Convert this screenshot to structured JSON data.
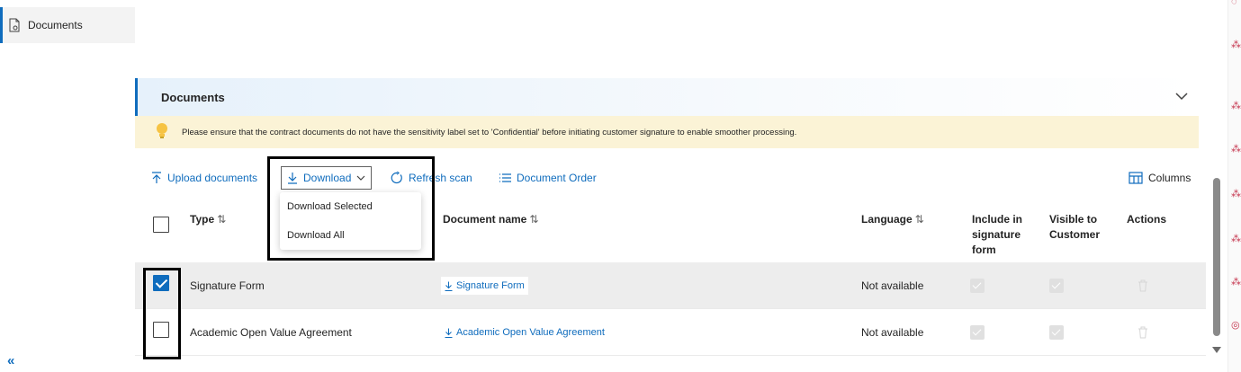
{
  "nav": {
    "documents_label": "Documents",
    "collapse_glyph": "«"
  },
  "section": {
    "title": "Documents"
  },
  "banner": {
    "text": "Please ensure that the contract documents do not have the sensitivity label set to 'Confidential' before initiating customer signature to enable smoother processing."
  },
  "toolbar": {
    "upload_label": "Upload documents",
    "download_label": "Download",
    "refresh_label": "Refresh scan",
    "order_label": "Document Order",
    "columns_label": "Columns"
  },
  "dropdown": {
    "items": [
      "Download Selected",
      "Download All"
    ]
  },
  "table": {
    "headers": {
      "type": "Type",
      "document_name": "Document name",
      "language": "Language",
      "include_line1": "Include in",
      "include_line2": "signature",
      "include_line3": "form",
      "visible_line1": "Visible to",
      "visible_line2": "Customer",
      "actions": "Actions"
    },
    "sort_glyph": "⇅",
    "rows": [
      {
        "type": "Signature Form",
        "document_name": "Signature Form",
        "language": "Not available",
        "checked": true
      },
      {
        "type": "Academic Open Value Agreement",
        "document_name": "Academic Open Value Agreement",
        "language": "Not available",
        "checked": false
      }
    ]
  },
  "colors": {
    "accent": "#0f6cbd",
    "banner_bg": "#fbf3d6",
    "rail_icon": "#c4314b"
  }
}
